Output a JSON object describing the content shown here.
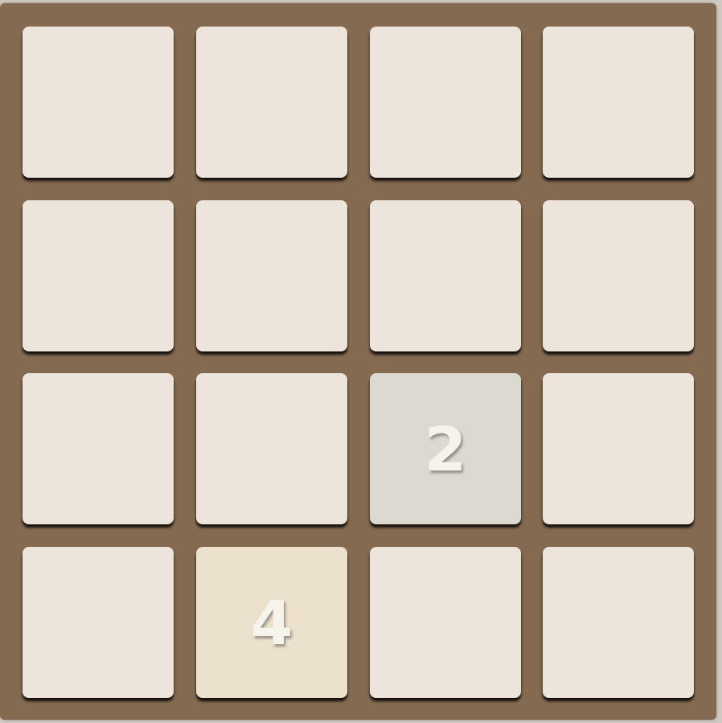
{
  "board": {
    "rows": 4,
    "cols": 4,
    "tiles": [
      [
        "",
        "",
        "",
        ""
      ],
      [
        "",
        "",
        "",
        ""
      ],
      [
        "",
        "",
        "2",
        ""
      ],
      [
        "",
        "4",
        "",
        ""
      ]
    ]
  },
  "colors": {
    "board_background": "#846a50",
    "empty_cell": "#ede5dc",
    "tile_2": "#dcd9d1",
    "tile_4": "#ece1cc",
    "tile_text": "#f6f2ec"
  }
}
